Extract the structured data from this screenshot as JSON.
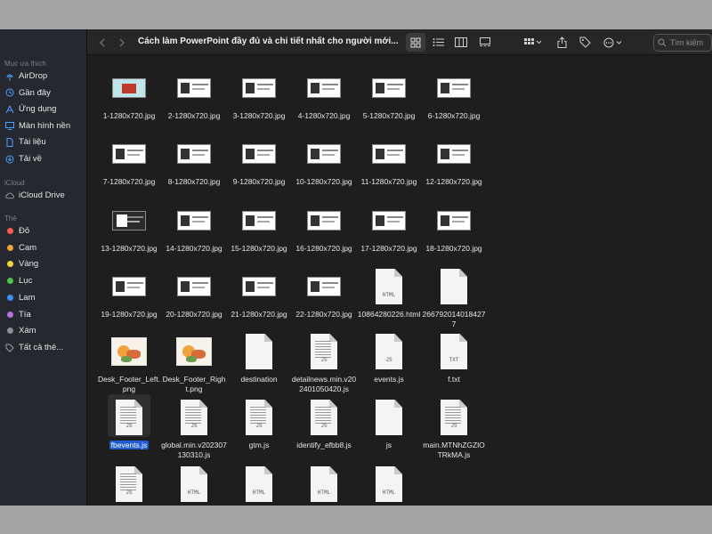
{
  "toolbar": {
    "title": "Cách làm PowerPoint đầy đủ và chi tiết nhất cho người mới...",
    "search_placeholder": "Tìm kiếm"
  },
  "sidebar": {
    "favorites_header": "Mục ưa thích",
    "favorites": [
      {
        "label": "AirDrop",
        "icon": "airdrop-icon"
      },
      {
        "label": "Gần đây",
        "icon": "clock-icon"
      },
      {
        "label": "Ứng dụng",
        "icon": "applications-icon"
      },
      {
        "label": "Màn hình nền",
        "icon": "desktop-icon"
      },
      {
        "label": "Tài liệu",
        "icon": "document-icon"
      },
      {
        "label": "Tải về",
        "icon": "download-icon"
      }
    ],
    "icloud_header": "iCloud",
    "icloud": [
      {
        "label": "iCloud Drive",
        "icon": "cloud-icon"
      }
    ],
    "tags_header": "Thẻ",
    "tags": [
      {
        "label": "Đỏ",
        "color": "#ff5b55"
      },
      {
        "label": "Cam",
        "color": "#f5a13c"
      },
      {
        "label": "Vàng",
        "color": "#f5d33c"
      },
      {
        "label": "Lục",
        "color": "#4cc54c"
      },
      {
        "label": "Lam",
        "color": "#3d8ff5"
      },
      {
        "label": "Tía",
        "color": "#b770e0"
      },
      {
        "label": "Xám",
        "color": "#8e8e93"
      }
    ],
    "all_tags": "Tất cả thẻ..."
  },
  "files": [
    {
      "name": "1-1280x720.jpg",
      "type": "slide-color"
    },
    {
      "name": "2-1280x720.jpg",
      "type": "slide"
    },
    {
      "name": "3-1280x720.jpg",
      "type": "slide"
    },
    {
      "name": "4-1280x720.jpg",
      "type": "slide"
    },
    {
      "name": "5-1280x720.jpg",
      "type": "slide"
    },
    {
      "name": "6-1280x720.jpg",
      "type": "slide"
    },
    {
      "name": "7-1280x720.jpg",
      "type": "slide"
    },
    {
      "name": "8-1280x720.jpg",
      "type": "slide"
    },
    {
      "name": "9-1280x720.jpg",
      "type": "slide"
    },
    {
      "name": "10-1280x720.jpg",
      "type": "slide"
    },
    {
      "name": "11-1280x720.jpg",
      "type": "slide"
    },
    {
      "name": "12-1280x720.jpg",
      "type": "slide"
    },
    {
      "name": "13-1280x720.jpg",
      "type": "slide-dark"
    },
    {
      "name": "14-1280x720.jpg",
      "type": "slide"
    },
    {
      "name": "15-1280x720.jpg",
      "type": "slide"
    },
    {
      "name": "16-1280x720.jpg",
      "type": "slide"
    },
    {
      "name": "17-1280x720.jpg",
      "type": "slide"
    },
    {
      "name": "18-1280x720.jpg",
      "type": "slide"
    },
    {
      "name": "19-1280x720.jpg",
      "type": "slide"
    },
    {
      "name": "20-1280x720.jpg",
      "type": "slide"
    },
    {
      "name": "21-1280x720.jpg",
      "type": "slide"
    },
    {
      "name": "22-1280x720.jpg",
      "type": "slide"
    },
    {
      "name": "10864280226.html",
      "type": "doc",
      "tag": "HTML"
    },
    {
      "name": "2667920140184277",
      "type": "doc",
      "tag": ""
    },
    {
      "name": "Desk_Footer_Left.png",
      "type": "image"
    },
    {
      "name": "Desk_Footer_Right.png",
      "type": "image"
    },
    {
      "name": "destination",
      "type": "doc",
      "tag": ""
    },
    {
      "name": "detailnews.min.v202401050420.js",
      "type": "doc-lines",
      "tag": "JS"
    },
    {
      "name": "events.js",
      "type": "doc",
      "tag": "JS"
    },
    {
      "name": "f.txt",
      "type": "doc",
      "tag": "TXT"
    },
    {
      "name": "fbevents.js",
      "type": "doc-lines",
      "tag": "JS",
      "selected": true
    },
    {
      "name": "global.min.v202307130310.js",
      "type": "doc-lines",
      "tag": "JS"
    },
    {
      "name": "gtm.js",
      "type": "doc-lines",
      "tag": "JS"
    },
    {
      "name": "identify_efbb8.js",
      "type": "doc-lines",
      "tag": "JS"
    },
    {
      "name": "js",
      "type": "doc",
      "tag": ""
    },
    {
      "name": "main.MTNhZGZlOTRkMA.js",
      "type": "doc-lines",
      "tag": "JS"
    },
    {
      "name": "",
      "type": "doc-lines",
      "tag": "JS"
    },
    {
      "name": "",
      "type": "doc",
      "tag": "HTML"
    },
    {
      "name": "",
      "type": "doc",
      "tag": "HTML"
    },
    {
      "name": "",
      "type": "doc",
      "tag": "HTML"
    },
    {
      "name": "",
      "type": "doc",
      "tag": "HTML"
    }
  ]
}
